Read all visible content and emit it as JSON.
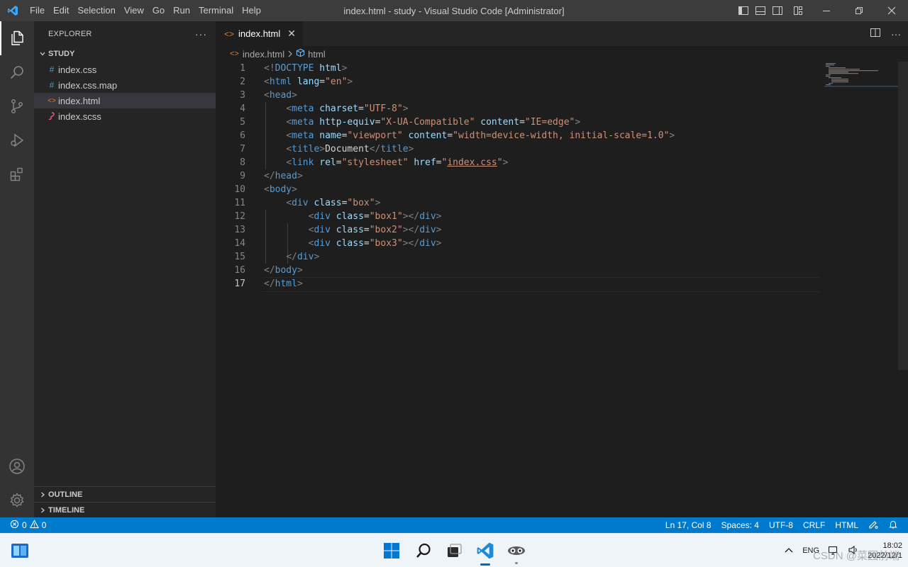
{
  "titlebar": {
    "menu": [
      "File",
      "Edit",
      "Selection",
      "View",
      "Go",
      "Run",
      "Terminal",
      "Help"
    ],
    "window_title": "index.html - study - Visual Studio Code [Administrator]"
  },
  "sidebar": {
    "header": "EXPLORER",
    "more": "···",
    "folder": "STUDY",
    "files": [
      {
        "name": "index.css",
        "icon": "#"
      },
      {
        "name": "index.css.map",
        "icon": "#"
      },
      {
        "name": "index.html",
        "icon": "<>"
      },
      {
        "name": "index.scss",
        "icon": "scss-icon"
      }
    ],
    "outline": "OUTLINE",
    "timeline": "TIMELINE"
  },
  "editor": {
    "tab_label": "index.html",
    "tab_close": "✕",
    "breadcrumb": {
      "file": "index.html",
      "symbol": "html"
    },
    "actions_more": "···",
    "current_line": 17,
    "lines": [
      [
        [
          "p",
          "<!"
        ],
        [
          "g",
          "DOCTYPE"
        ],
        [
          "s",
          " "
        ],
        [
          "a",
          "html"
        ],
        [
          "p",
          ">"
        ]
      ],
      [
        [
          "p",
          "<"
        ],
        [
          "g",
          "html"
        ],
        [
          "s",
          " "
        ],
        [
          "a",
          "lang"
        ],
        [
          "s",
          "="
        ],
        [
          "r",
          "\"en\""
        ],
        [
          "p",
          ">"
        ]
      ],
      [
        [
          "p",
          "<"
        ],
        [
          "g",
          "head"
        ],
        [
          "p",
          ">"
        ]
      ],
      [
        [
          "s",
          "    "
        ],
        [
          "p",
          "<"
        ],
        [
          "g",
          "meta"
        ],
        [
          "s",
          " "
        ],
        [
          "a",
          "charset"
        ],
        [
          "s",
          "="
        ],
        [
          "r",
          "\"UTF-8\""
        ],
        [
          "p",
          ">"
        ]
      ],
      [
        [
          "s",
          "    "
        ],
        [
          "p",
          "<"
        ],
        [
          "g",
          "meta"
        ],
        [
          "s",
          " "
        ],
        [
          "a",
          "http-equiv"
        ],
        [
          "s",
          "="
        ],
        [
          "r",
          "\"X-UA-Compatible\""
        ],
        [
          "s",
          " "
        ],
        [
          "a",
          "content"
        ],
        [
          "s",
          "="
        ],
        [
          "r",
          "\"IE=edge\""
        ],
        [
          "p",
          ">"
        ]
      ],
      [
        [
          "s",
          "    "
        ],
        [
          "p",
          "<"
        ],
        [
          "g",
          "meta"
        ],
        [
          "s",
          " "
        ],
        [
          "a",
          "name"
        ],
        [
          "s",
          "="
        ],
        [
          "r",
          "\"viewport\""
        ],
        [
          "s",
          " "
        ],
        [
          "a",
          "content"
        ],
        [
          "s",
          "="
        ],
        [
          "r",
          "\"width=device-width, initial-scale=1.0\""
        ],
        [
          "p",
          ">"
        ]
      ],
      [
        [
          "s",
          "    "
        ],
        [
          "p",
          "<"
        ],
        [
          "g",
          "title"
        ],
        [
          "p",
          ">"
        ],
        [
          "s",
          "Document"
        ],
        [
          "p",
          "</"
        ],
        [
          "g",
          "title"
        ],
        [
          "p",
          ">"
        ]
      ],
      [
        [
          "s",
          "    "
        ],
        [
          "p",
          "<"
        ],
        [
          "g",
          "link"
        ],
        [
          "s",
          " "
        ],
        [
          "a",
          "rel"
        ],
        [
          "s",
          "="
        ],
        [
          "r",
          "\"stylesheet\""
        ],
        [
          "s",
          " "
        ],
        [
          "a",
          "href"
        ],
        [
          "s",
          "="
        ],
        [
          "r",
          "\""
        ],
        [
          "l",
          "index.css"
        ],
        [
          "r",
          "\""
        ],
        [
          "p",
          ">"
        ]
      ],
      [
        [
          "p",
          "</"
        ],
        [
          "g",
          "head"
        ],
        [
          "p",
          ">"
        ]
      ],
      [
        [
          "p",
          "<"
        ],
        [
          "g",
          "body"
        ],
        [
          "p",
          ">"
        ]
      ],
      [
        [
          "s",
          "    "
        ],
        [
          "p",
          "<"
        ],
        [
          "g",
          "div"
        ],
        [
          "s",
          " "
        ],
        [
          "a",
          "class"
        ],
        [
          "s",
          "="
        ],
        [
          "r",
          "\"box\""
        ],
        [
          "p",
          ">"
        ]
      ],
      [
        [
          "s",
          "        "
        ],
        [
          "p",
          "<"
        ],
        [
          "g",
          "div"
        ],
        [
          "s",
          " "
        ],
        [
          "a",
          "class"
        ],
        [
          "s",
          "="
        ],
        [
          "r",
          "\"box1\""
        ],
        [
          "p",
          "></"
        ],
        [
          "g",
          "div"
        ],
        [
          "p",
          ">"
        ]
      ],
      [
        [
          "s",
          "        "
        ],
        [
          "p",
          "<"
        ],
        [
          "g",
          "div"
        ],
        [
          "s",
          " "
        ],
        [
          "a",
          "class"
        ],
        [
          "s",
          "="
        ],
        [
          "r",
          "\"box2\""
        ],
        [
          "p",
          "></"
        ],
        [
          "g",
          "div"
        ],
        [
          "p",
          ">"
        ]
      ],
      [
        [
          "s",
          "        "
        ],
        [
          "p",
          "<"
        ],
        [
          "g",
          "div"
        ],
        [
          "s",
          " "
        ],
        [
          "a",
          "class"
        ],
        [
          "s",
          "="
        ],
        [
          "r",
          "\"box3\""
        ],
        [
          "p",
          "></"
        ],
        [
          "g",
          "div"
        ],
        [
          "p",
          ">"
        ]
      ],
      [
        [
          "s",
          "    "
        ],
        [
          "p",
          "</"
        ],
        [
          "g",
          "div"
        ],
        [
          "p",
          ">"
        ]
      ],
      [
        [
          "p",
          "</"
        ],
        [
          "g",
          "body"
        ],
        [
          "p",
          ">"
        ]
      ],
      [
        [
          "p",
          "</"
        ],
        [
          "g",
          "html"
        ],
        [
          "p",
          ">"
        ]
      ]
    ]
  },
  "statusbar": {
    "errors": "0",
    "warnings": "0",
    "position": "Ln 17, Col 8",
    "spaces": "Spaces: 4",
    "encoding": "UTF-8",
    "eol": "CRLF",
    "language": "HTML"
  },
  "taskbar": {
    "lang": "ENG",
    "time": "18:02",
    "date": "2022/12/1",
    "watermark": "CSDN @菜园前端"
  },
  "colors": {
    "accent": "#007acc",
    "titlebar": "#3c3c3c",
    "activitybar": "#333333",
    "sidebar": "#252526",
    "editor": "#1e1e1e",
    "tag": "#569cd6",
    "attribute": "#9cdcfe",
    "string": "#ce9178"
  }
}
